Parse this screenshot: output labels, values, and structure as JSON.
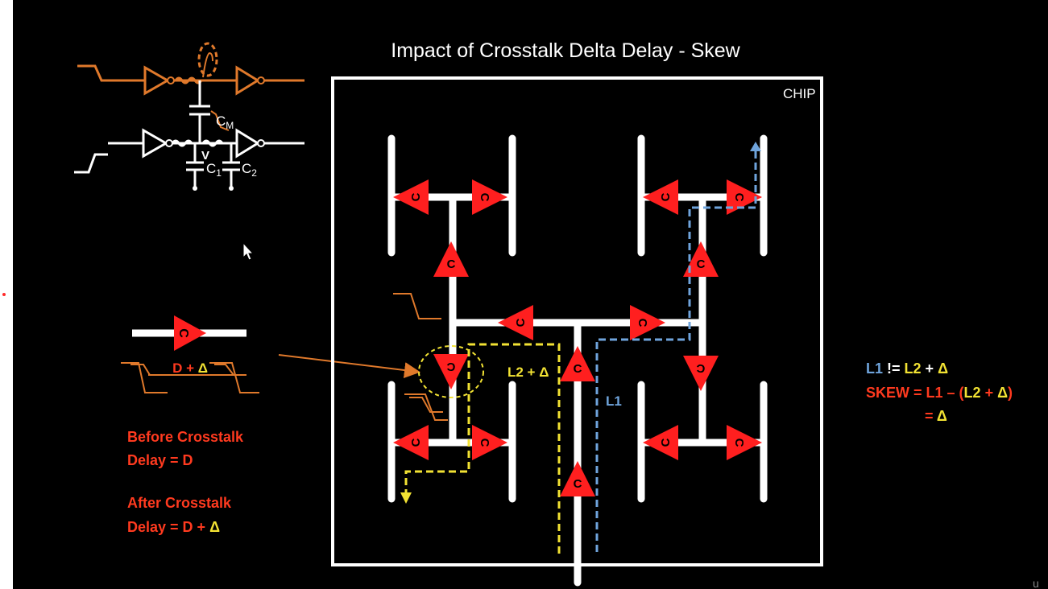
{
  "title": "Impact of Crosstalk Delta Delay - Skew",
  "chip_label": "CHIP",
  "crosstalk_circuit": {
    "cm_label": "C",
    "cm_sub": "M",
    "v_label": "V",
    "c1_label": "C",
    "c1_sub": "1",
    "c2_label": "C",
    "c2_sub": "2"
  },
  "buffer_symbol": "C",
  "delay_label": {
    "prefix": "D + ",
    "delta": "Δ"
  },
  "path_labels": {
    "l2_prefix": "L2 + ",
    "l2_delta": "Δ",
    "l1": "L1"
  },
  "notes": {
    "before_line1": "Before Crosstalk",
    "before_line2": "Delay = D",
    "after_line1": "After Crosstalk",
    "after_line2_prefix": "Delay = D + ",
    "after_line2_delta": "Δ"
  },
  "equations": {
    "eq1_l1": "L1",
    "eq1_op": " != ",
    "eq1_l2": "L2",
    "eq1_plus": " + ",
    "eq1_delta": "Δ",
    "eq2_skew": "SKEW",
    "eq2_eq": " = ",
    "eq2_l1": "L1",
    "eq2_minus": " – (",
    "eq2_l2": "L2",
    "eq2_plus": " + ",
    "eq2_delta": "Δ",
    "eq2_close": ")",
    "eq3_eq": "= ",
    "eq3_delta": "Δ"
  },
  "colors": {
    "background": "#000000",
    "wire": "#ffffff",
    "buffer": "#ff1f1f",
    "aggressor": "#e0792b",
    "yellow": "#f2e233",
    "blue": "#6fa4dc",
    "red_text": "#ff3a1f"
  }
}
